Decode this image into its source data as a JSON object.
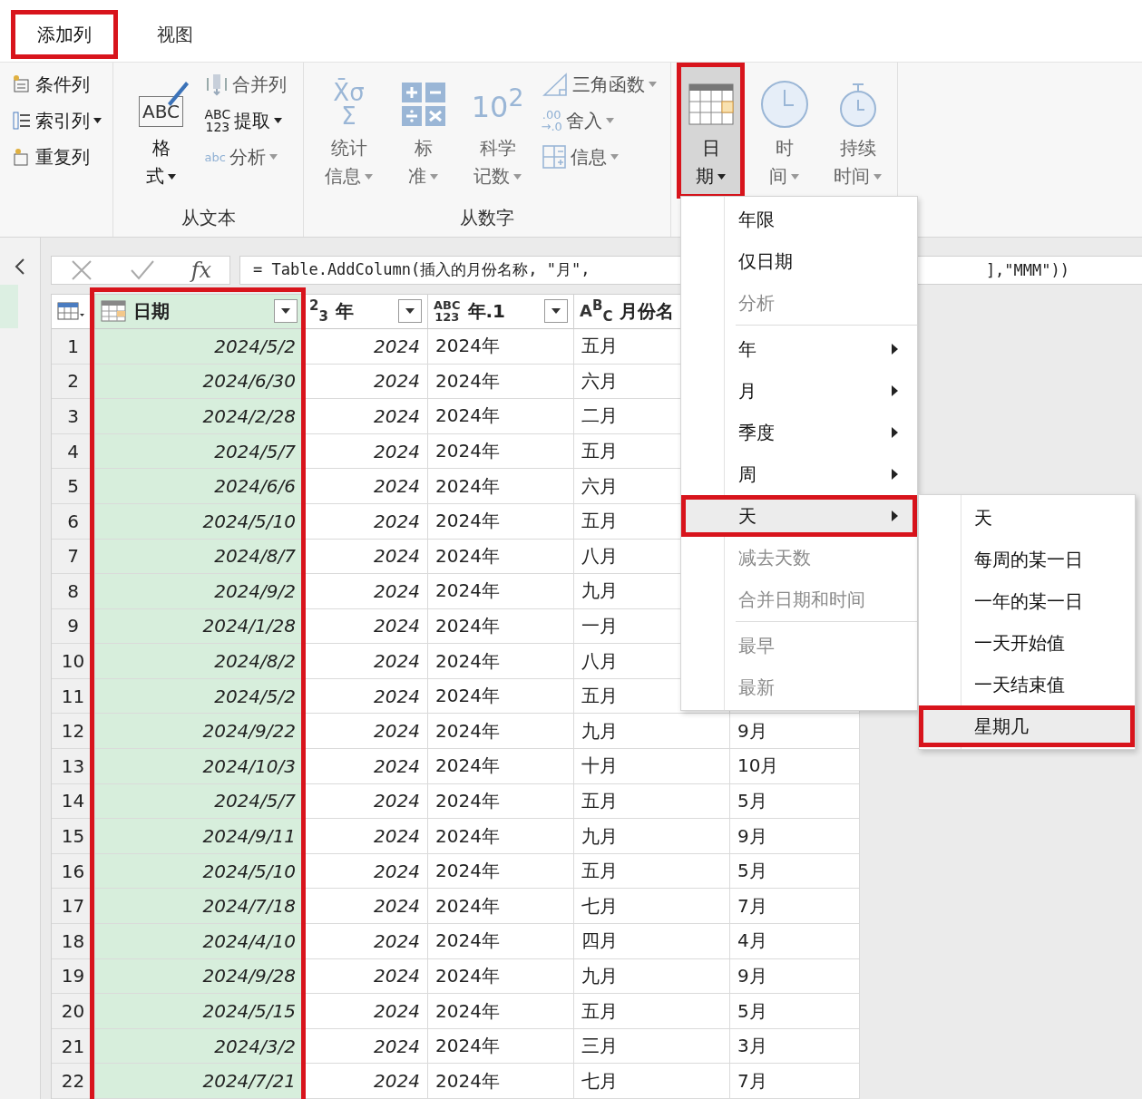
{
  "tabs": [
    {
      "label": "添加列",
      "selected": true,
      "highlighted": true
    },
    {
      "label": "视图",
      "selected": false,
      "highlighted": false
    }
  ],
  "ribbon": {
    "groups": [
      {
        "items": [
          {
            "kind": "stack",
            "buttons": [
              {
                "label": "条件列",
                "dropdown": false,
                "disabled": false
              },
              {
                "label": "索引列",
                "dropdown": true,
                "disabled": false
              },
              {
                "label": "重复列",
                "dropdown": false,
                "disabled": false
              }
            ]
          }
        ]
      },
      {
        "label": "从文本",
        "items": [
          {
            "kind": "large",
            "lines": [
              "格",
              "式"
            ],
            "icon_text": "ABC",
            "dropdown": true,
            "disabled": false,
            "highlighted": false
          },
          {
            "kind": "stack",
            "buttons": [
              {
                "label": "合并列",
                "dropdown": false,
                "disabled": true
              },
              {
                "label": "提取",
                "icon_text": "ABC\n123",
                "dropdown": true,
                "disabled": false
              },
              {
                "label": "分析",
                "icon_text": "abc",
                "dropdown": true,
                "disabled": true
              }
            ]
          }
        ]
      },
      {
        "label": "从数字",
        "items": [
          {
            "kind": "large",
            "lines": [
              "统计",
              "信息"
            ],
            "icon_text": "X̄σ\nΣ",
            "dropdown": true,
            "disabled": true,
            "highlighted": false
          },
          {
            "kind": "large",
            "lines": [
              "标",
              "准"
            ],
            "dropdown": true,
            "disabled": true,
            "highlighted": false
          },
          {
            "kind": "large",
            "lines": [
              "科学",
              "记数"
            ],
            "icon_text": "10$^{2}$",
            "dropdown": true,
            "disabled": true,
            "highlighted": false
          },
          {
            "kind": "stack",
            "buttons": [
              {
                "label": "三角函数",
                "dropdown": true,
                "disabled": true
              },
              {
                "label": "舍入",
                "icon_text": ".00\n→.0",
                "dropdown": true,
                "disabled": true
              },
              {
                "label": "信息",
                "dropdown": true,
                "disabled": true
              }
            ]
          }
        ]
      },
      {
        "items": [
          {
            "kind": "large",
            "lines": [
              "日",
              "期"
            ],
            "dropdown": true,
            "disabled": false,
            "highlighted": true
          },
          {
            "kind": "large",
            "lines": [
              "时",
              "间"
            ],
            "dropdown": true,
            "disabled": true,
            "highlighted": false
          },
          {
            "kind": "large",
            "lines": [
              "持续",
              "时间"
            ],
            "dropdown": true,
            "disabled": true,
            "highlighted": false
          }
        ]
      }
    ]
  },
  "formula": {
    "fx": "fx",
    "text_start": "= Table.AddColumn(插入的月份名称, \"月\",",
    "text_end": "],\"MMM\"))"
  },
  "columns": [
    {
      "label": "日期",
      "highlighted": true
    },
    {
      "type_label": "$^{2}$$_{3}$",
      "label": "年",
      "highlighted": false
    },
    {
      "type_label": "ABC\n123",
      "label": "年.1",
      "highlighted": false
    },
    {
      "type_label": "A$^{B}$$_{C}$",
      "label": "月份名",
      "highlighted": false
    }
  ],
  "rows": [
    {
      "row_number": "1",
      "date": "2024/5/2",
      "year": "2024",
      "year_text": "2024年",
      "month_name": "五月"
    },
    {
      "row_number": "2",
      "date": "2024/6/30",
      "year": "2024",
      "year_text": "2024年",
      "month_name": "六月"
    },
    {
      "row_number": "3",
      "date": "2024/2/28",
      "year": "2024",
      "year_text": "2024年",
      "month_name": "二月"
    },
    {
      "row_number": "4",
      "date": "2024/5/7",
      "year": "2024",
      "year_text": "2024年",
      "month_name": "五月"
    },
    {
      "row_number": "5",
      "date": "2024/6/6",
      "year": "2024",
      "year_text": "2024年",
      "month_name": "六月"
    },
    {
      "row_number": "6",
      "date": "2024/5/10",
      "year": "2024",
      "year_text": "2024年",
      "month_name": "五月"
    },
    {
      "row_number": "7",
      "date": "2024/8/7",
      "year": "2024",
      "year_text": "2024年",
      "month_name": "八月"
    },
    {
      "row_number": "8",
      "date": "2024/9/2",
      "year": "2024",
      "year_text": "2024年",
      "month_name": "九月"
    },
    {
      "row_number": "9",
      "date": "2024/1/28",
      "year": "2024",
      "year_text": "2024年",
      "month_name": "一月"
    },
    {
      "row_number": "10",
      "date": "2024/8/2",
      "year": "2024",
      "year_text": "2024年",
      "month_name": "八月"
    },
    {
      "row_number": "11",
      "date": "2024/5/2",
      "year": "2024",
      "year_text": "2024年",
      "month_name": "五月"
    },
    {
      "row_number": "12",
      "date": "2024/9/22",
      "year": "2024",
      "year_text": "2024年",
      "month_name": "九月",
      "column_5": "9月"
    },
    {
      "row_number": "13",
      "date": "2024/10/3",
      "year": "2024",
      "year_text": "2024年",
      "month_name": "十月",
      "column_5": "10月"
    },
    {
      "row_number": "14",
      "date": "2024/5/7",
      "year": "2024",
      "year_text": "2024年",
      "month_name": "五月",
      "column_5": "5月"
    },
    {
      "row_number": "15",
      "date": "2024/9/11",
      "year": "2024",
      "year_text": "2024年",
      "month_name": "九月",
      "column_5": "9月"
    },
    {
      "row_number": "16",
      "date": "2024/5/10",
      "year": "2024",
      "year_text": "2024年",
      "month_name": "五月",
      "column_5": "5月"
    },
    {
      "row_number": "17",
      "date": "2024/7/18",
      "year": "2024",
      "year_text": "2024年",
      "month_name": "七月",
      "column_5": "7月"
    },
    {
      "row_number": "18",
      "date": "2024/4/10",
      "year": "2024",
      "year_text": "2024年",
      "month_name": "四月",
      "column_5": "4月"
    },
    {
      "row_number": "19",
      "date": "2024/9/28",
      "year": "2024",
      "year_text": "2024年",
      "month_name": "九月",
      "column_5": "9月"
    },
    {
      "row_number": "20",
      "date": "2024/5/15",
      "year": "2024",
      "year_text": "2024年",
      "month_name": "五月",
      "column_5": "5月"
    },
    {
      "row_number": "21",
      "date": "2024/3/2",
      "year": "2024",
      "year_text": "2024年",
      "month_name": "三月",
      "column_5": "3月"
    },
    {
      "row_number": "22",
      "date": "2024/7/21",
      "year": "2024",
      "year_text": "2024年",
      "month_name": "七月",
      "column_5": "7月"
    }
  ],
  "date_menu": {
    "items": [
      {
        "kind": "item",
        "label": "年限",
        "disabled": false,
        "submenu": false,
        "highlighted": false
      },
      {
        "kind": "item",
        "label": "仅日期",
        "disabled": false,
        "submenu": false,
        "highlighted": false
      },
      {
        "kind": "item",
        "label": "分析",
        "disabled": true,
        "submenu": false,
        "highlighted": false
      },
      {
        "kind": "separator"
      },
      {
        "kind": "item",
        "label": "年",
        "disabled": false,
        "submenu": true,
        "highlighted": false
      },
      {
        "kind": "item",
        "label": "月",
        "disabled": false,
        "submenu": true,
        "highlighted": false
      },
      {
        "kind": "item",
        "label": "季度",
        "disabled": false,
        "submenu": true,
        "highlighted": false
      },
      {
        "kind": "item",
        "label": "周",
        "disabled": false,
        "submenu": true,
        "highlighted": false
      },
      {
        "kind": "item",
        "label": "天",
        "disabled": false,
        "submenu": true,
        "highlighted": true
      },
      {
        "kind": "item",
        "label": "减去天数",
        "disabled": true,
        "submenu": false,
        "highlighted": false
      },
      {
        "kind": "item",
        "label": "合并日期和时间",
        "disabled": true,
        "submenu": false,
        "highlighted": false
      },
      {
        "kind": "separator"
      },
      {
        "kind": "item",
        "label": "最早",
        "disabled": true,
        "submenu": false,
        "highlighted": false
      },
      {
        "kind": "item",
        "label": "最新",
        "disabled": true,
        "submenu": false,
        "highlighted": false
      }
    ]
  },
  "day_submenu": {
    "items": [
      {
        "label": "天",
        "highlighted": false
      },
      {
        "label": "每周的某一日",
        "highlighted": false
      },
      {
        "label": "一年的某一日",
        "highlighted": false
      },
      {
        "label": "一天开始值",
        "highlighted": false
      },
      {
        "label": "一天结束值",
        "highlighted": false
      },
      {
        "label": "星期几",
        "highlighted": true
      }
    ]
  }
}
